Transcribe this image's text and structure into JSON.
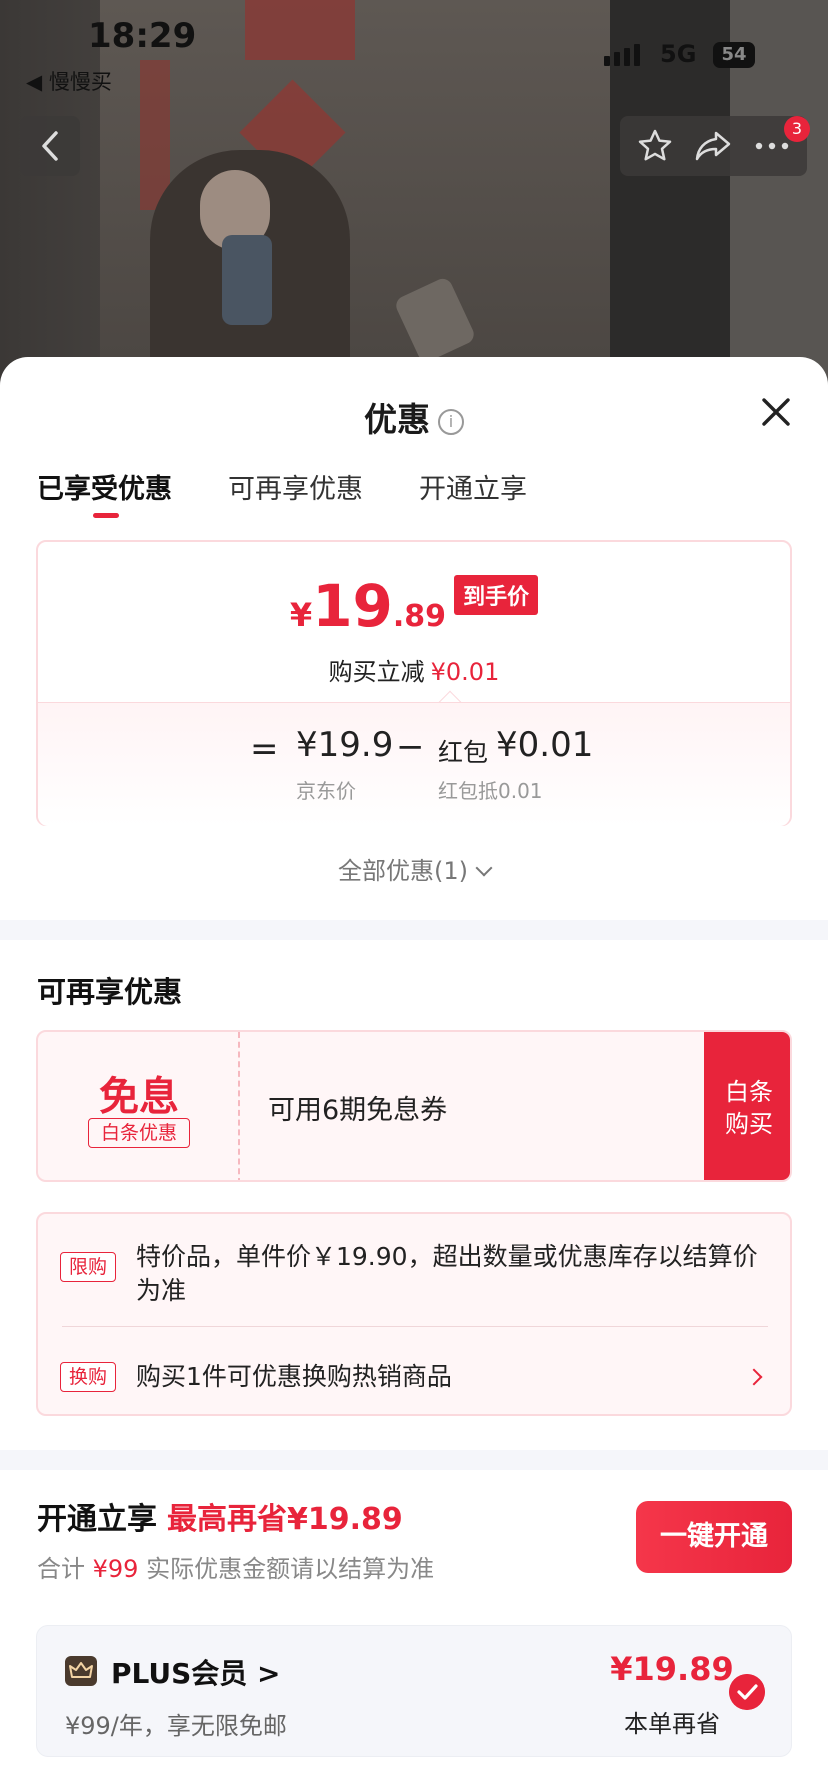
{
  "status_bar": {
    "time": "18:29",
    "back_app": "◀ 慢慢买",
    "network": "5G",
    "battery": "54"
  },
  "header": {
    "cart_badge": "3"
  },
  "sheet": {
    "title": "优惠",
    "tabs": [
      {
        "label": "已享受优惠",
        "active": true
      },
      {
        "label": "可再享优惠",
        "active": false
      },
      {
        "label": "开通立享",
        "active": false
      }
    ]
  },
  "price_card": {
    "currency": "¥",
    "price_int": "19",
    "price_dec": ".89",
    "price_tag": "到手价",
    "reduce_label": "购买立减",
    "reduce_value": "¥0.01",
    "equals": "=",
    "jd_price": "¥19.9",
    "jd_label": "京东价",
    "minus": "−",
    "redpacket_label": "红包",
    "redpacket_value": "¥0.01",
    "redpacket_sub": "红包抵0.01"
  },
  "all_discounts": "全部优惠(1)",
  "more_discounts": {
    "title": "可再享优惠",
    "interest": {
      "big": "免息",
      "small": "白条优惠",
      "desc": "可用6期免息券",
      "cta_line1": "白条",
      "cta_line2": "购买"
    },
    "limits": [
      {
        "tag": "限购",
        "text": "特价品，单件价￥19.90，超出数量或优惠库存以结算价为准"
      },
      {
        "tag": "换购",
        "text": "购买1件可优惠换购热销商品"
      }
    ]
  },
  "plus": {
    "title": "开通立享",
    "title_highlight": "最高再省¥19.89",
    "sub_prefix": "合计",
    "sub_amount": "¥99",
    "sub_suffix": "实际优惠金额请以结算为准",
    "button": "一键开通",
    "member_name": "PLUS会员 >",
    "member_desc": "¥99/年，享无限免邮",
    "save_price": "¥19.89",
    "save_label": "本单再省"
  },
  "colors": {
    "accent": "#e8243b",
    "light_bg": "#fff6f7",
    "divider": "#f5f6fa"
  }
}
